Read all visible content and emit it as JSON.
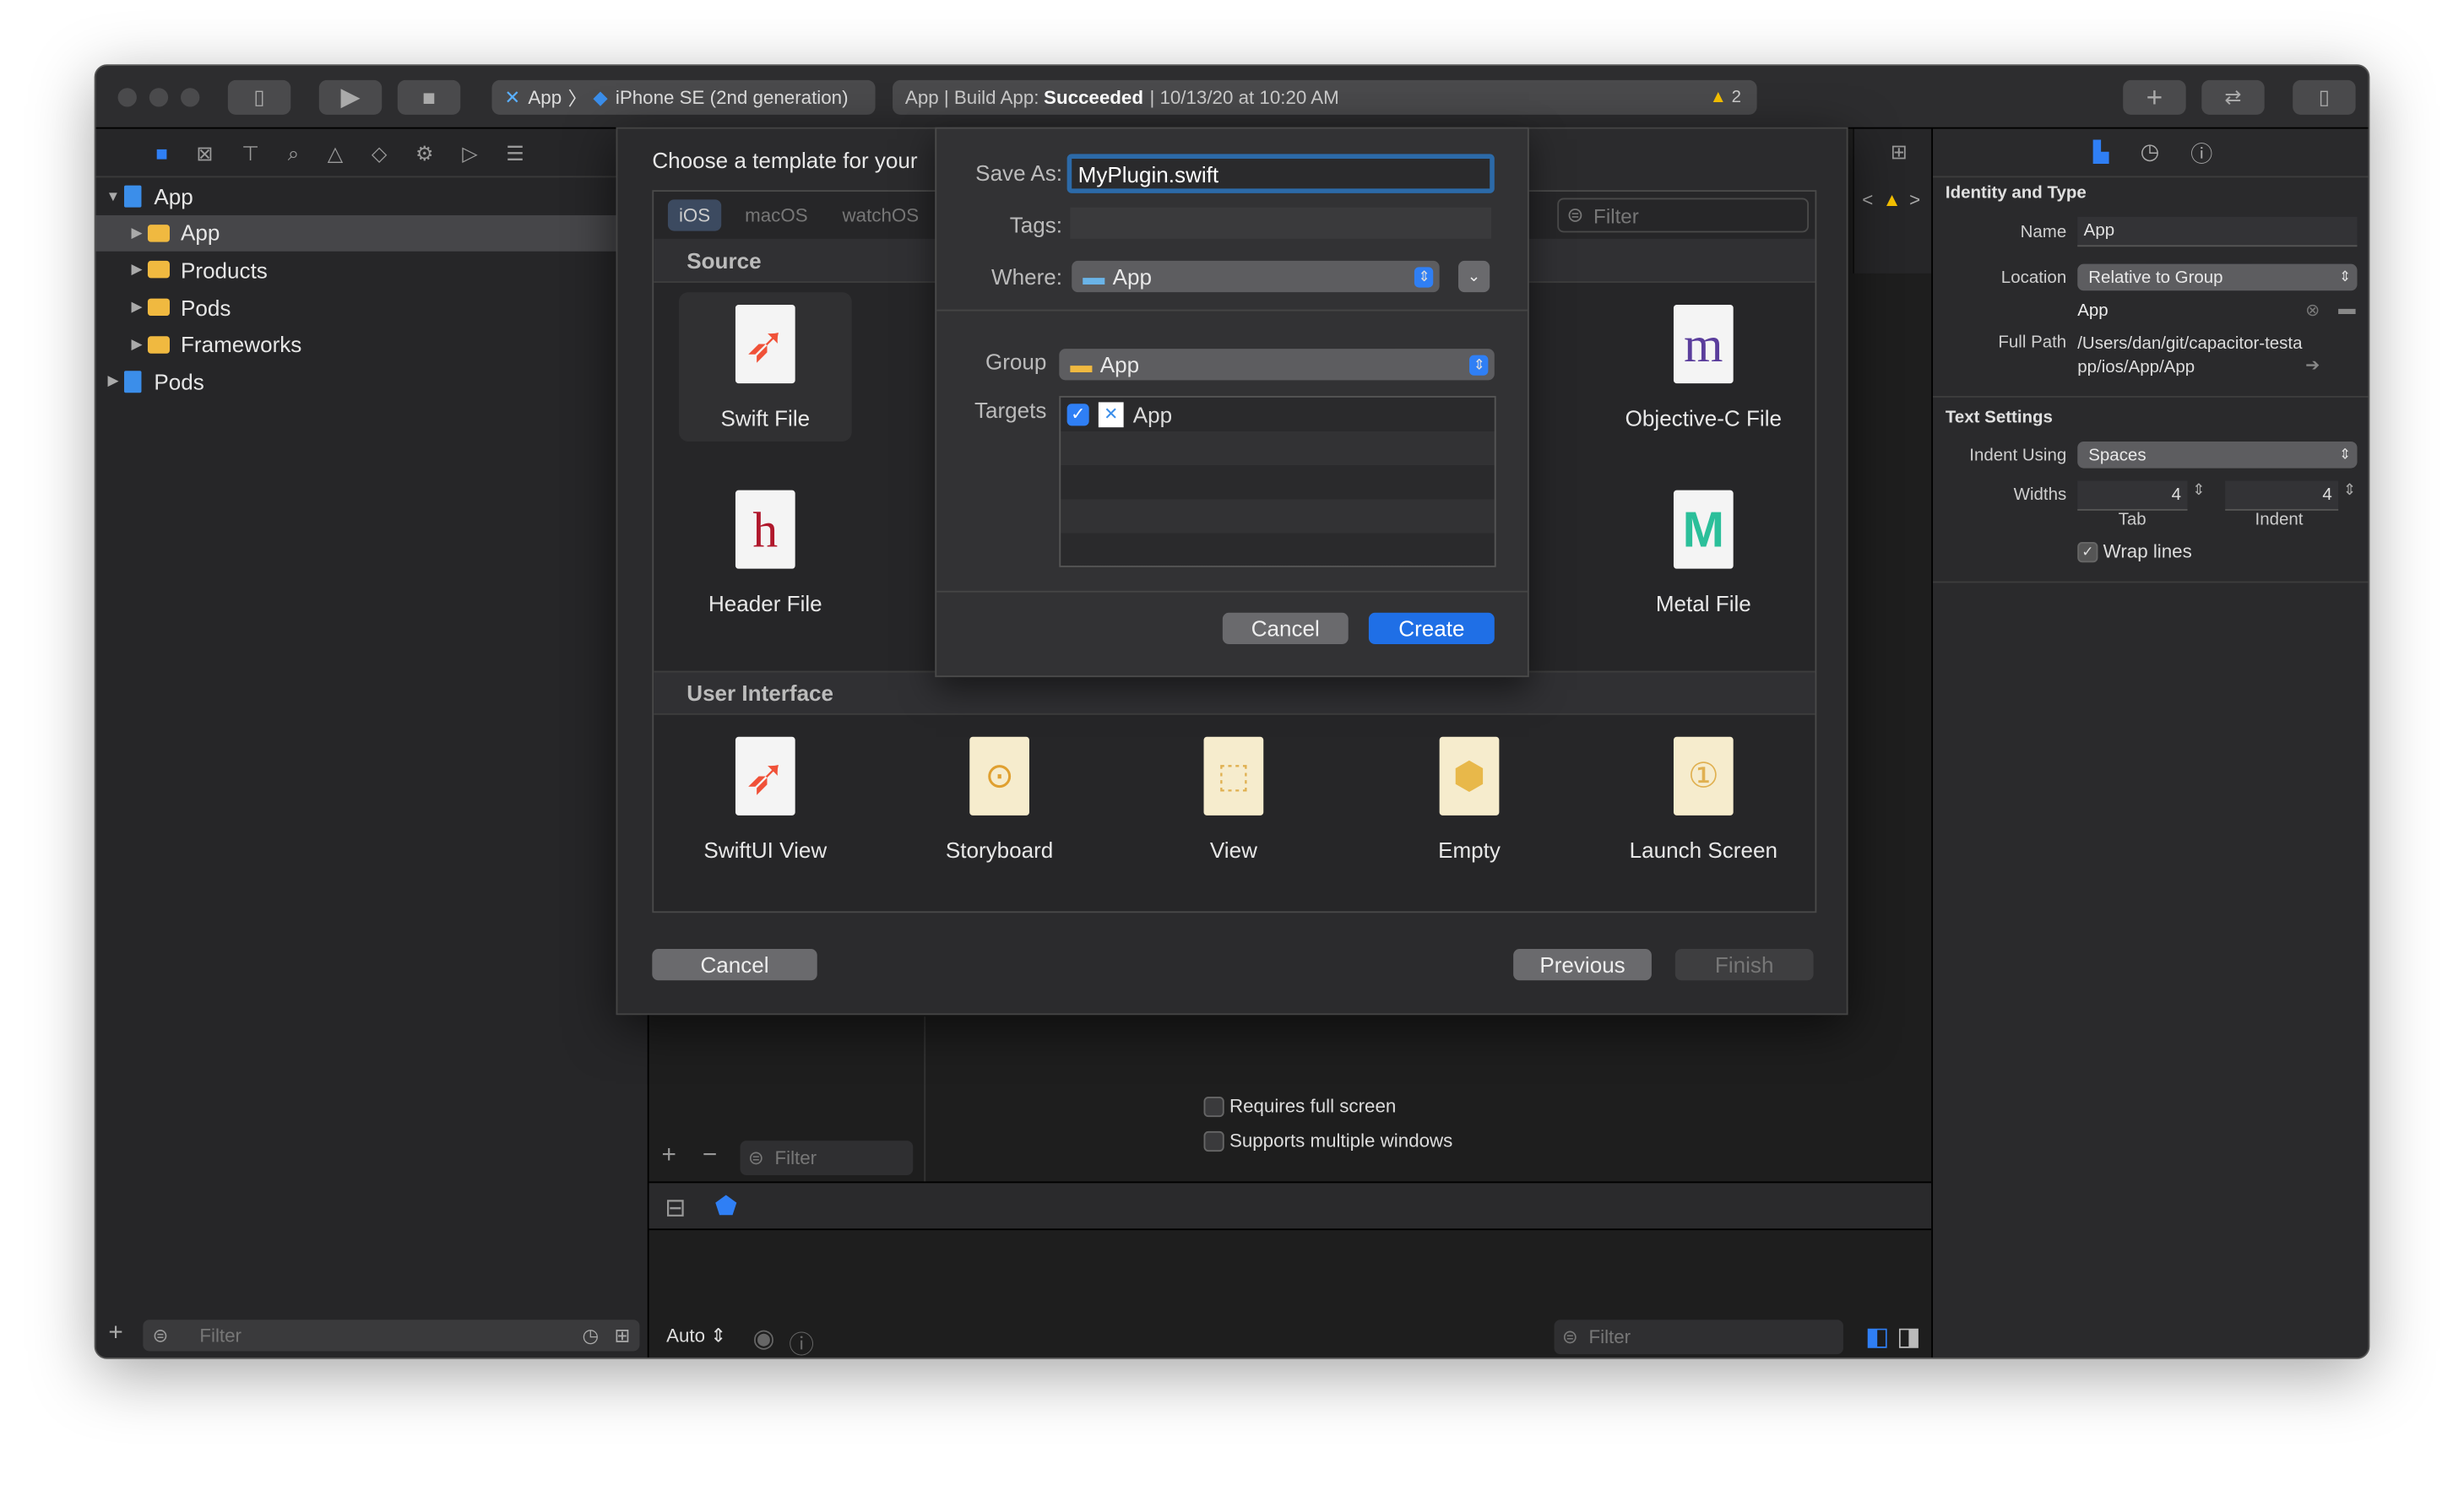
{
  "toolbar": {
    "scheme": "App",
    "device": "iPhone SE (2nd generation)",
    "status_prefix": "App | Build App: ",
    "status_result": "Succeeded",
    "status_time": "| 10/13/20 at 10:20 AM",
    "warning_count": "2",
    "add": "+",
    "swap": "⇄"
  },
  "navigator": {
    "items": [
      {
        "label": "App",
        "type": "project",
        "level": 0,
        "open": true
      },
      {
        "label": "App",
        "type": "folder",
        "level": 1,
        "selected": true
      },
      {
        "label": "Products",
        "type": "folder",
        "level": 1
      },
      {
        "label": "Pods",
        "type": "folder",
        "level": 1
      },
      {
        "label": "Frameworks",
        "type": "folder",
        "level": 1
      },
      {
        "label": "Pods",
        "type": "project",
        "level": 0
      }
    ],
    "filter_placeholder": "Filter"
  },
  "chooser": {
    "title": "Choose a template for your",
    "tabs": [
      "iOS",
      "macOS",
      "watchOS"
    ],
    "filter_placeholder": "Filter",
    "source_header": "Source",
    "ui_header": "User Interface",
    "source": [
      {
        "label": "Swift File",
        "glyph": "swift"
      },
      {
        "label": "Objective-C File",
        "glyph": "m"
      },
      {
        "label": "Header File",
        "glyph": "h"
      },
      {
        "label": "Metal File",
        "glyph": "M"
      }
    ],
    "ui": [
      {
        "label": "SwiftUI View"
      },
      {
        "label": "Storyboard"
      },
      {
        "label": "View"
      },
      {
        "label": "Empty"
      },
      {
        "label": "Launch Screen"
      }
    ],
    "cancel": "Cancel",
    "previous": "Previous",
    "finish": "Finish"
  },
  "save": {
    "save_as_label": "Save As:",
    "save_as_value": "MyPlugin.swift",
    "tags_label": "Tags:",
    "where_label": "Where:",
    "where_value": "App",
    "group_label": "Group",
    "group_value": "App",
    "targets_label": "Targets",
    "target": "App",
    "target_checked": true,
    "cancel": "Cancel",
    "create": "Create"
  },
  "editor": {
    "requires_full_screen": "Requires full screen",
    "supports_multiple_windows": "Supports multiple windows",
    "filter_placeholder": "Filter",
    "auto": "Auto",
    "bottom_filter": "Filter"
  },
  "inspector": {
    "identity_header": "Identity and Type",
    "name_label": "Name",
    "name_value": "App",
    "location_label": "Location",
    "location_value": "Relative to Group",
    "location_file": "App",
    "full_path_label": "Full Path",
    "full_path_value": "/Users/dan/git/capacitor-testapp/ios/App/App",
    "text_header": "Text Settings",
    "indent_using_label": "Indent Using",
    "indent_using_value": "Spaces",
    "widths_label": "Widths",
    "tab_value": "4",
    "indent_value": "4",
    "tab_label": "Tab",
    "indent_label": "Indent",
    "wrap_lines": "Wrap lines",
    "wrap_checked": true
  },
  "colors": {
    "accent": "#2f7ff5",
    "warning": "#f5c000"
  }
}
